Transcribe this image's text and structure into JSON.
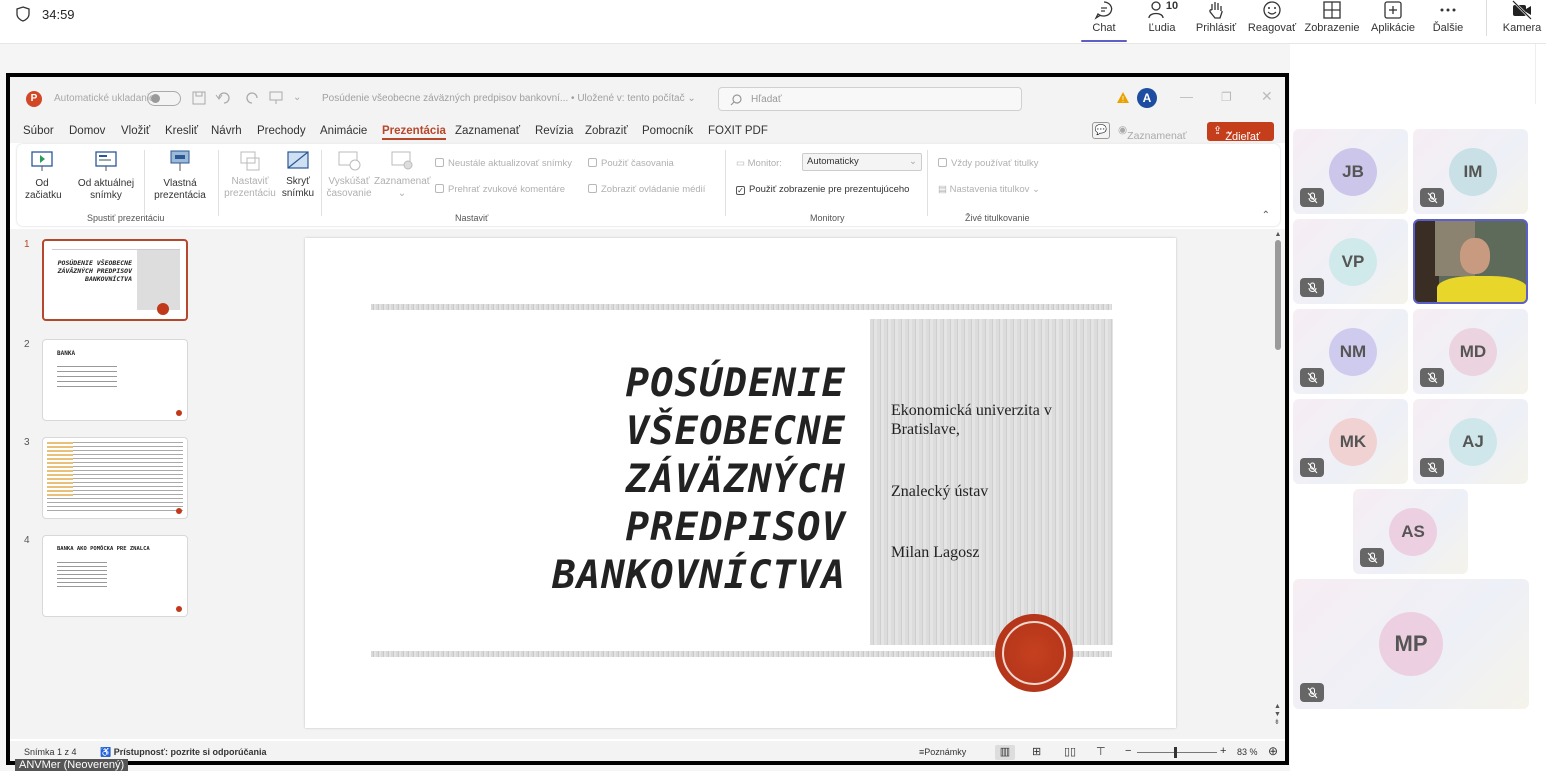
{
  "meeting": {
    "timer": "34:59",
    "toolbar": [
      {
        "label": "Chat",
        "icon": "chat-icon"
      },
      {
        "label": "Ľudia",
        "icon": "people-icon",
        "badge": "10"
      },
      {
        "label": "Prihlásiť",
        "icon": "raise-hand-icon"
      },
      {
        "label": "Reagovať",
        "icon": "smiley-icon"
      },
      {
        "label": "Zobrazenie",
        "icon": "layout-grid-icon"
      },
      {
        "label": "Aplikácie",
        "icon": "add-app-icon"
      },
      {
        "label": "Ďalšie",
        "icon": "more-icon"
      },
      {
        "label": "Kamera",
        "icon": "camera-off-icon"
      }
    ],
    "presenter_label": "ANVMer (Neoverený)"
  },
  "ppt": {
    "autosave_label": "Automatické ukladanie",
    "doc_title": "Posúdenie všeobecne záväzných predpisov bankovní... • Uložené v: tento počítač ⌄",
    "search_placeholder": "Hľadať",
    "profile_initial": "A",
    "tabs": [
      "Súbor",
      "Domov",
      "Vložiť",
      "Kresliť",
      "Návrh",
      "Prechody",
      "Animácie",
      "Prezentácia",
      "Zaznamenať",
      "Revízia",
      "Zobraziť",
      "Pomocník",
      "FOXIT PDF"
    ],
    "active_tab": "Prezentácia",
    "record_label": "Zaznamenať",
    "share_label": "Zdieľať",
    "ribbon": {
      "from_start": "Od začiatku",
      "from_current": "Od aktuálnej snímky",
      "custom": "Vlastná prezentácia",
      "group1": "Spustiť prezentáciu",
      "setup": "Nastaviť prezentáciu",
      "hide": "Skryť snímku",
      "rehearse": "Vyskúšať časovanie",
      "record": "Zaznamenať",
      "opt_keep_updated": "Neustále aktualizovať snímky",
      "opt_use_timings": "Použiť časovania",
      "opt_narration": "Prehrať zvukové komentáre",
      "opt_media": "Zobraziť ovládanie médií",
      "group2": "Nastaviť",
      "monitor_label": "Monitor:",
      "monitor_value": "Automaticky",
      "presenter_view": "Použiť zobrazenie pre prezentujúceho",
      "group3": "Monitory",
      "always_subtitles": "Vždy používať titulky",
      "subtitle_settings": "Nastavenia titulkov",
      "group4": "Živé titulkovanie"
    },
    "thumbnails": [
      {
        "num": "1",
        "title": "POSÚDENIE VŠEOBECNE ZÁVÄZNÝCH PREDPISOV BANKOVNÍCTVA"
      },
      {
        "num": "2",
        "title": "BANKA"
      },
      {
        "num": "3",
        "title": ""
      },
      {
        "num": "4",
        "title": "BANKA AKO POMÔCKA PRE ZNALCA"
      }
    ],
    "slide": {
      "title_lines": [
        "POSÚDENIE",
        "VŠEOBECNE",
        "ZÁVÄZNÝCH",
        "PREDPISOV",
        "BANKOVNÍCTVA"
      ],
      "info1": "Ekonomická univerzita v Bratislave,",
      "info2": "Znalecký ústav",
      "info3": "Milan Lagosz"
    },
    "status": {
      "slide_counter": "Snímka 1 z 4",
      "accessibility": "Prístupnosť: pozrite si odporúčania",
      "notes": "Poznámky",
      "zoom": "83 %"
    }
  },
  "participants": [
    {
      "initials": "JB",
      "color": "#cbc6ea"
    },
    {
      "initials": "IM",
      "color": "#c8e0e6"
    },
    {
      "initials": "VP",
      "color": "#d0eaec"
    },
    {
      "initials": "",
      "video": true
    },
    {
      "initials": "NM",
      "color": "#cfcbee"
    },
    {
      "initials": "MD",
      "color": "#ecd3e0"
    },
    {
      "initials": "MK",
      "color": "#f1d2d2"
    },
    {
      "initials": "AJ",
      "color": "#cfe7ea"
    },
    {
      "initials": "AS",
      "color": "#ecd0e2"
    },
    {
      "initials": "MP",
      "color": "#ecd0e2"
    }
  ]
}
